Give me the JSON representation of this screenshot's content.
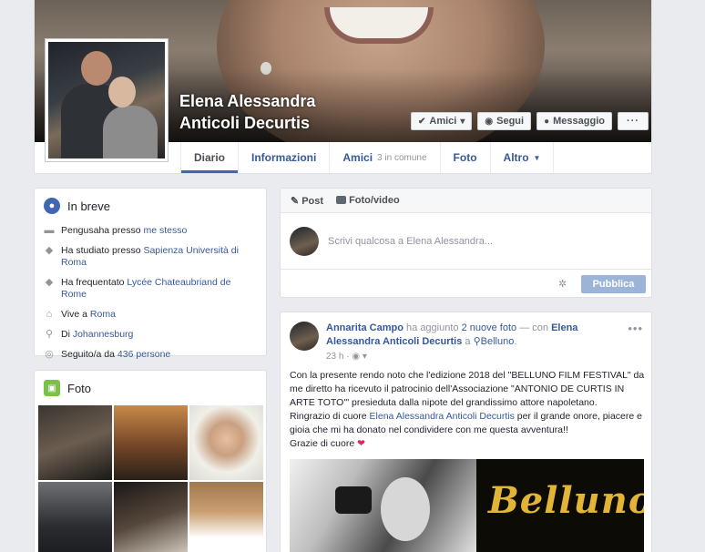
{
  "profile": {
    "name_line1": "Elena Alessandra",
    "name_line2": "Anticoli Decurtis",
    "buttons": {
      "friends": "Amici",
      "follow": "Segui",
      "message": "Messaggio",
      "more": "···"
    }
  },
  "tabs": [
    {
      "label": "Diario"
    },
    {
      "label": "Informazioni"
    },
    {
      "label": "Amici",
      "sub": "3 in comune"
    },
    {
      "label": "Foto"
    },
    {
      "label": "Altro"
    }
  ],
  "intro": {
    "title": "In breve",
    "items": [
      {
        "icon": "briefcase-icon",
        "text": "Pengusaha presso ",
        "link": "me stesso"
      },
      {
        "icon": "graduation-cap-icon",
        "text": "Ha studiato presso ",
        "link": "Sapienza Università di Roma"
      },
      {
        "icon": "graduation-cap-icon",
        "text": "Ha frequentato ",
        "link": "Lycée Chateaubriand de Rome"
      },
      {
        "icon": "home-icon",
        "text": "Vive a ",
        "link": "Roma"
      },
      {
        "icon": "location-pin-icon",
        "text": "Di ",
        "link": "Johannesburg"
      },
      {
        "icon": "rss-icon",
        "text": "Seguito/a da ",
        "link": "436 persone"
      }
    ]
  },
  "photos": {
    "title": "Foto"
  },
  "composer": {
    "tab_post": "Post",
    "tab_photo": "Foto/video",
    "placeholder": "Scrivi qualcosa a Elena Alessandra...",
    "publish": "Pubblica"
  },
  "post": {
    "author": "Annarita Campo",
    "action": " ha aggiunto ",
    "photos": "2 nuove foto",
    "with": " — con ",
    "tagged": "Elena Alessandra Anticoli Decurtis",
    "at": " a ",
    "place": "Belluno",
    "time": "23 h",
    "text_1": "Con la presente rendo noto che l'edizione 2018 del \"BELLUNO FILM FESTIVAL\" da me diretto ha ricevuto il patrocinio dell'Associazione \"ANTONIO DE CURTIS IN ARTE TOTO'\" presieduta dalla nipote del grandissimo attore napoletano.",
    "text_2a": "Ringrazio di cuore ",
    "text_2link": "Elena Alessandra Anticoli Decurtis",
    "text_2b": " per il grande onore, piacere e gioia che mi ha donato nel condividere con me questa avventura!!",
    "text_3": "Grazie di cuore ",
    "image_text": "Belluno"
  }
}
